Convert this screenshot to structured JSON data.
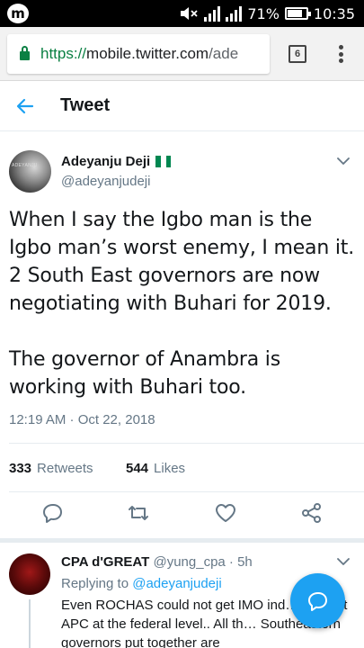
{
  "status_bar": {
    "app_icon": "m",
    "battery_percent": "71%",
    "battery_level": 0.71,
    "time": "10:35",
    "icons": [
      "mute-icon",
      "signal-icon",
      "battery-icon"
    ]
  },
  "browser": {
    "url_scheme": "https://",
    "url_host": "mobile.twitter.com",
    "url_path": "/ade",
    "tab_count": "6"
  },
  "header": {
    "title": "Tweet"
  },
  "tweet": {
    "author_name": "Adeyanju Deji",
    "author_handle": "@adeyanjudeji",
    "avatar_text": "ADEYANJU",
    "text": "When I say the Igbo man is the Igbo man’s worst enemy, I mean it. 2 South East governors are now negotiating with Buhari for 2019.\n\nThe governor of Anambra is working with Buhari too.",
    "timestamp": "12:19 AM · Oct 22, 2018",
    "retweet_count": "333",
    "retweet_label": "Retweets",
    "like_count": "544",
    "like_label": "Likes",
    "flag_colors": [
      "#008751",
      "#ffffff",
      "#008751"
    ]
  },
  "reply": {
    "author_name": "CPA d'GREAT",
    "author_handle": "@yung_cpa",
    "separator": "·",
    "time": "5h",
    "replying_prefix": "Replying to",
    "replying_to": "@adeyanjudeji",
    "text": "Even ROCHAS could not get IMO ind… support APC at the federal level.. All th… Southeastern governors put together are"
  },
  "colors": {
    "accent": "#1da1f2",
    "secure": "#0b8043",
    "muted": "#657786"
  }
}
